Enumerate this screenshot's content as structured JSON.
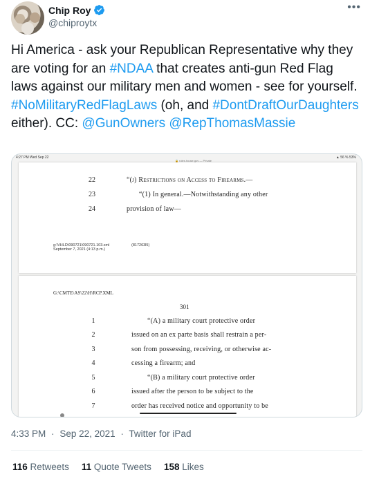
{
  "author": {
    "name": "Chip Roy",
    "handle": "@chiproytx",
    "more_label": "•••"
  },
  "tweet": {
    "segments": [
      {
        "text": "Hi America - ask your Republican Representative why they are voting for an ",
        "link": false
      },
      {
        "text": "#NDAA",
        "link": true
      },
      {
        "text": " that creates anti-gun Red Flag laws against our military men and women - see for yourself.  ",
        "link": false
      },
      {
        "text": "#NoMilitaryRedFlagLaws",
        "link": true
      },
      {
        "text": " (oh, and ",
        "link": false
      },
      {
        "text": "#DontDraftOurDaughters",
        "link": true
      },
      {
        "text": " either). CC: ",
        "link": false
      },
      {
        "text": "@GunOwners",
        "link": true
      },
      {
        "text": " ",
        "link": false
      },
      {
        "text": "@RepThomasMassie",
        "link": true
      }
    ]
  },
  "media": {
    "status_bar": {
      "time": "4:27 PM  Wed Sep 22",
      "url": "🔒 rules.house.gov — Private",
      "battery": "▲ 56 % 53%"
    },
    "page1": {
      "lines": [
        {
          "num": "22",
          "text": "“(j) Restrictions on Access to Firearms.—"
        },
        {
          "num": "23",
          "text": "“(1) In general.—Notwithstanding any other"
        },
        {
          "num": "24",
          "text": "provision of law—"
        }
      ],
      "footer_path": "g:\\VHLD\\090721\\090721.103.xml",
      "footer_date": "September 7, 2021 (4:13 p.m.)",
      "footer_id": "(817263l5)"
    },
    "page2": {
      "header": "G:\\CMTE\\AS\\22\\H\\RCP.XML",
      "page_number": "301",
      "lines": [
        {
          "num": "1",
          "text": "“(A) a military court protective order"
        },
        {
          "num": "2",
          "text": "issued on an ex parte basis shall restrain a per-"
        },
        {
          "num": "3",
          "text": "son from possessing, receiving, or otherwise ac-"
        },
        {
          "num": "4",
          "text": "cessing a firearm; and"
        },
        {
          "num": "5",
          "text": "“(B) a military court protective order"
        },
        {
          "num": "6",
          "text": "issued after the person to be subject to the"
        },
        {
          "num": "7",
          "text": "order has received notice and opportunity to be"
        }
      ]
    }
  },
  "meta": {
    "time": "4:33 PM",
    "separator": "·",
    "date": "Sep 22, 2021",
    "source": "Twitter for iPad"
  },
  "stats": {
    "retweets_count": "116",
    "retweets_label": "Retweets",
    "quotes_count": "11",
    "quotes_label": "Quote Tweets",
    "likes_count": "158",
    "likes_label": "Likes"
  },
  "colors": {
    "link": "#1d9bf0",
    "verified": "#1d9bf0",
    "secondary_text": "#536471"
  }
}
